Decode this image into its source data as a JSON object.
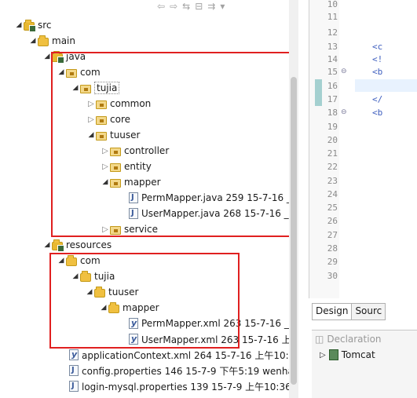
{
  "toolbar": {
    "icons": [
      "back-icon",
      "forward-icon",
      "link-icon",
      "collapse-icon",
      "sync-icon",
      "menu-icon"
    ]
  },
  "tree": {
    "src": "src",
    "main": "main",
    "java": "java",
    "com": "com",
    "tujia": "tujia",
    "common": "common",
    "core": "core",
    "tuuser": "tuuser",
    "controller": "controller",
    "entity": "entity",
    "mapper": "mapper",
    "perm_mapper_java": "PermMapper.java 259  15-7-16 _",
    "user_mapper_java": "UserMapper.java 268  15-7-16 _",
    "service": "service",
    "resources": "resources",
    "res_com": "com",
    "res_tujia": "tujia",
    "res_tuuser": "tuuser",
    "res_mapper": "mapper",
    "perm_mapper_xml": "PermMapper.xml 263  15-7-16 _",
    "user_mapper_xml": "UserMapper.xml 263  15-7-16 上",
    "application_context": "applicationContext.xml 264  15-7-16 上午10:4",
    "config_properties": "config.properties 146  15-7-9 下午5:19  wenha",
    "login_mysql": "login-mysql.properties 139  15-7-9 上午10:36"
  },
  "editor": {
    "line_numbers": [
      "10",
      "11",
      "12",
      "13",
      "14",
      "15",
      "16",
      "17",
      "18",
      "19",
      "20",
      "21",
      "22",
      "23",
      "24",
      "25",
      "26",
      "27",
      "28",
      "29",
      "30"
    ],
    "code_fragments": {
      "l13": "<c",
      "l14": "<!",
      "l15": "<b",
      "l17": "</",
      "l18": "<b"
    },
    "tabs": {
      "design": "Design",
      "source": "Sourc"
    }
  },
  "declaration_panel": {
    "title": "Declaration",
    "server": "Tomcat"
  },
  "colors": {
    "highlight_red": "#e02020",
    "folder_yellow": "#f0c040"
  }
}
